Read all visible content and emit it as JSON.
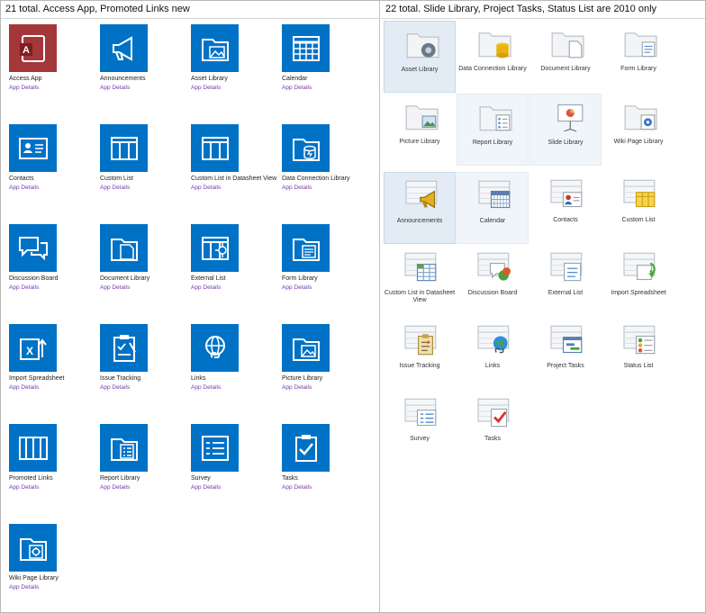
{
  "left": {
    "header": "21 total. Access App, Promoted Links new",
    "details_label": "App Details",
    "apps": [
      {
        "name": "Access App",
        "icon": "access-icon"
      },
      {
        "name": "Announcements",
        "icon": "megaphone-icon"
      },
      {
        "name": "Asset Library",
        "icon": "asset-library-icon"
      },
      {
        "name": "Calendar",
        "icon": "calendar-icon"
      },
      {
        "name": "Contacts",
        "icon": "contact-card-icon"
      },
      {
        "name": "Custom List",
        "icon": "list-grid-icon"
      },
      {
        "name": "Custom List in Datasheet View",
        "icon": "datasheet-icon"
      },
      {
        "name": "Data Connection Library",
        "icon": "data-connection-icon"
      },
      {
        "name": "Discussion Board",
        "icon": "speech-bubbles-icon"
      },
      {
        "name": "Document Library",
        "icon": "document-folder-icon"
      },
      {
        "name": "External List",
        "icon": "external-list-icon"
      },
      {
        "name": "Form Library",
        "icon": "form-folder-icon"
      },
      {
        "name": "Import Spreadsheet",
        "icon": "excel-import-icon"
      },
      {
        "name": "Issue Tracking",
        "icon": "clipboard-icon"
      },
      {
        "name": "Links",
        "icon": "globe-link-icon"
      },
      {
        "name": "Picture Library",
        "icon": "picture-folder-icon"
      },
      {
        "name": "Promoted Links",
        "icon": "promoted-links-icon"
      },
      {
        "name": "Report Library",
        "icon": "report-folder-icon"
      },
      {
        "name": "Survey",
        "icon": "survey-icon"
      },
      {
        "name": "Tasks",
        "icon": "checkbox-icon"
      },
      {
        "name": "Wiki Page Library",
        "icon": "wiki-folder-icon"
      }
    ]
  },
  "right": {
    "header": "22 total. Slide Library, Project Tasks, Status List are 2010 only",
    "items": [
      {
        "name": "Asset Library",
        "icon": "asset-library-icon",
        "state": "selected"
      },
      {
        "name": "Data Connection Library",
        "icon": "data-connection-icon"
      },
      {
        "name": "Document Library",
        "icon": "document-folder-icon"
      },
      {
        "name": "Form Library",
        "icon": "form-folder-icon"
      },
      {
        "name": "Picture Library",
        "icon": "picture-folder-icon"
      },
      {
        "name": "Report Library",
        "icon": "report-folder-icon",
        "state": "hover"
      },
      {
        "name": "Slide Library",
        "icon": "slide-library-icon",
        "state": "hover"
      },
      {
        "name": "Wiki Page Library",
        "icon": "wiki-folder-icon"
      },
      {
        "name": "Announcements",
        "icon": "megaphone-icon",
        "state": "selected"
      },
      {
        "name": "Calendar",
        "icon": "calendar-icon",
        "state": "hover"
      },
      {
        "name": "Contacts",
        "icon": "contact-card-icon"
      },
      {
        "name": "Custom List",
        "icon": "list-grid-icon"
      },
      {
        "name": "Custom List in Datasheet View",
        "icon": "datasheet-icon"
      },
      {
        "name": "Discussion Board",
        "icon": "speech-bubbles-icon"
      },
      {
        "name": "External List",
        "icon": "external-list-icon"
      },
      {
        "name": "Import Spreadsheet",
        "icon": "excel-import-icon"
      },
      {
        "name": "Issue Tracking",
        "icon": "clipboard-icon"
      },
      {
        "name": "Links",
        "icon": "globe-link-icon"
      },
      {
        "name": "Project Tasks",
        "icon": "project-tasks-icon"
      },
      {
        "name": "Status List",
        "icon": "status-list-icon"
      },
      {
        "name": "Survey",
        "icon": "survey-icon"
      },
      {
        "name": "Tasks",
        "icon": "checkbox-icon"
      }
    ]
  },
  "colors": {
    "tile_blue": "#0072c6",
    "access_red": "#a4373a",
    "details_purple": "#7536b0"
  }
}
